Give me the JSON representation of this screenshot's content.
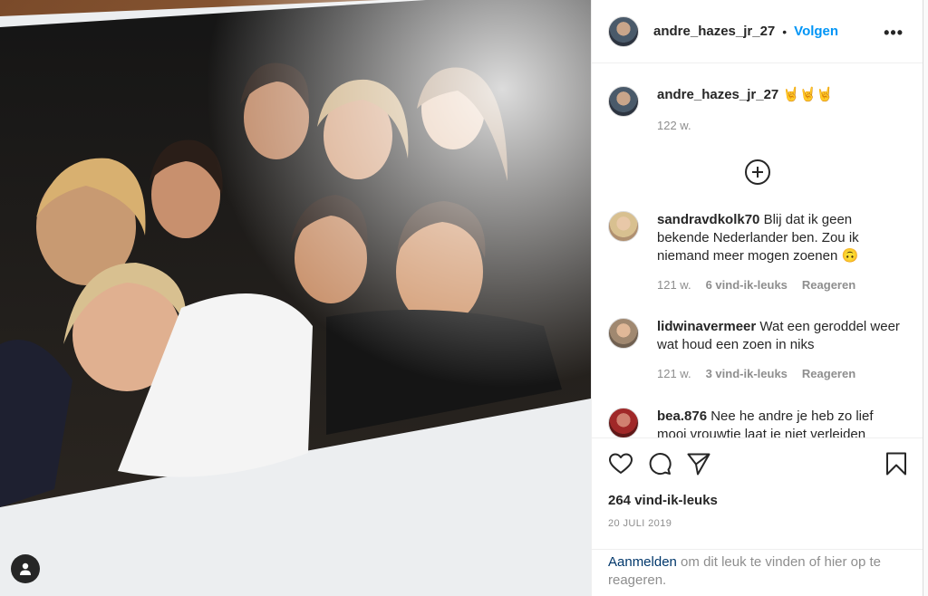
{
  "post": {
    "username": "andre_hazes_jr_27",
    "dot": "•",
    "follow_label": "Volgen",
    "more_label": "•••"
  },
  "caption": {
    "username": "andre_hazes_jr_27",
    "text": "🤘🤘🤘",
    "time": "122 w."
  },
  "comments": [
    {
      "username": "sandravdkolk70",
      "text": "Blij dat ik geen bekende Nederlander ben. Zou ik niemand meer mogen zoenen 🙃",
      "time": "121 w.",
      "likes": "6 vind-ik-leuks",
      "reply": "Reageren"
    },
    {
      "username": "lidwinavermeer",
      "text": "Wat een geroddel weer wat houd een zoen in niks",
      "time": "121 w.",
      "likes": "3 vind-ik-leuks",
      "reply": "Reageren"
    },
    {
      "username": "bea.876",
      "text": "Nee he andre je heb zo lief mooi vrouwtje laat je niet verleiden",
      "time": "",
      "likes": "",
      "reply": ""
    }
  ],
  "actions": {
    "like_count": "264 vind-ik-leuks",
    "date": "20 JULI 2019"
  },
  "login": {
    "link": "Aanmelden",
    "rest": " om dit leuk te vinden of hier op te reageren."
  },
  "icons": [
    "heart-icon",
    "comment-icon",
    "share-icon",
    "bookmark-icon",
    "plus-circle-icon",
    "user-icon",
    "more-icon"
  ],
  "colors": {
    "accent": "#0095f6",
    "text": "#262626",
    "muted": "#8e8e8e",
    "link": "#00376b"
  }
}
